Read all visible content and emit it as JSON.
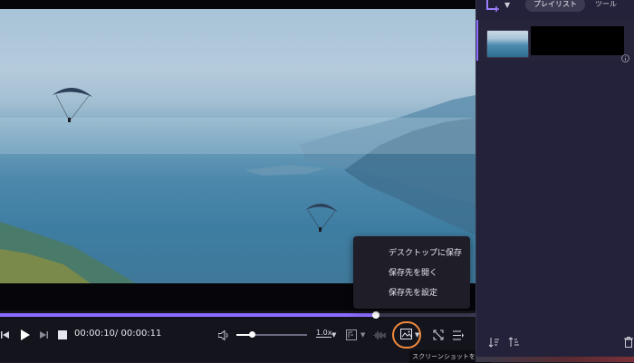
{
  "player": {
    "progress_fraction": 0.79,
    "current_time": "00:00:10",
    "separator": "/",
    "total_time": "00:00:11",
    "volume_fraction": 0.22,
    "speed_label": "1.0x"
  },
  "capture_menu": {
    "items": [
      {
        "label": "デスクトップに保存"
      },
      {
        "label": "保存先を開く"
      },
      {
        "label": "保存先を設定"
      }
    ],
    "tooltip": "スクリーンショットを撮る"
  },
  "right_panel": {
    "tabs": [
      {
        "label": "プレイリスト",
        "active": true
      },
      {
        "label": "ツール",
        "active": false
      }
    ]
  },
  "colors": {
    "accent": "#8b6cff",
    "highlight_ring": "#f08a3c",
    "panel_bg": "#23223a"
  }
}
